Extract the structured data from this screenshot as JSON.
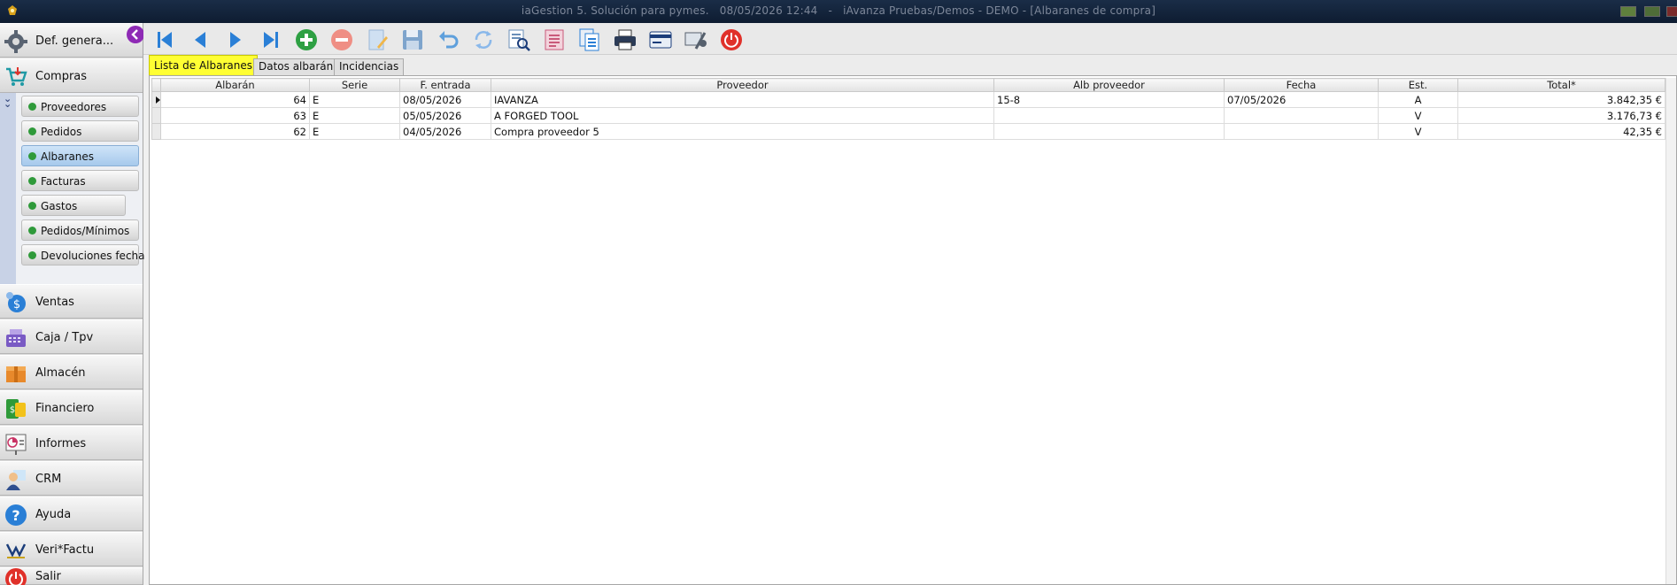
{
  "window": {
    "app_name": "iaGestion 5. Solución para pymes.",
    "datetime": "08/05/2026 12:44",
    "separator": "-",
    "company": "iAvanza Pruebas/Demos - DEMO - [Albaranes de compra]"
  },
  "sidebar": {
    "top_items": [
      {
        "label": "Def. genera...",
        "icon": "gear-icon"
      },
      {
        "label": "Compras",
        "icon": "shopping-cart-icon"
      }
    ],
    "sub_items": [
      {
        "label": "Proveedores"
      },
      {
        "label": "Pedidos"
      },
      {
        "label": "Albaranes"
      },
      {
        "label": "Facturas"
      },
      {
        "label": "Gastos"
      },
      {
        "label": "Pedidos/Mínimos"
      },
      {
        "label": "Devoluciones fecha"
      }
    ],
    "active_sub": "Albaranes",
    "bottom_items": [
      {
        "label": "Ventas",
        "icon": "sales-icon"
      },
      {
        "label": "Caja / Tpv",
        "icon": "cash-register-icon"
      },
      {
        "label": "Almacén",
        "icon": "warehouse-box-icon"
      },
      {
        "label": "Financiero",
        "icon": "money-icon"
      },
      {
        "label": "Informes",
        "icon": "report-chart-icon"
      },
      {
        "label": "CRM",
        "icon": "crm-person-icon"
      },
      {
        "label": "Ayuda",
        "icon": "help-icon"
      },
      {
        "label": "Veri*Factu",
        "icon": "verifactu-logo-icon"
      },
      {
        "label": "Salir",
        "icon": "exit-power-icon"
      }
    ]
  },
  "toolbar": {
    "tools": [
      "first-record-icon",
      "previous-record-icon",
      "next-record-icon",
      "last-record-icon",
      "add-icon",
      "delete-icon",
      "edit-icon",
      "save-icon",
      "undo-icon",
      "refresh-icon",
      "search-document-icon",
      "report-icon",
      "copy-document-icon",
      "print-icon",
      "card-icon",
      "tools-settings-icon",
      "close-power-icon"
    ]
  },
  "tabs": [
    {
      "label": "Lista de Albaranes",
      "active": true
    },
    {
      "label": "Datos albarán",
      "active": false
    },
    {
      "label": "Incidencias",
      "active": false
    }
  ],
  "grid": {
    "columns": [
      "Albarán",
      "Serie",
      "F. entrada",
      "Proveedor",
      "Alb proveedor",
      "Fecha",
      "Est.",
      "Total*"
    ],
    "rows": [
      {
        "albaran": "64",
        "serie": "E",
        "f_entrada": "08/05/2026",
        "proveedor": "IAVANZA",
        "alb_proveedor": "15-8",
        "fecha": "07/05/2026",
        "est": "A",
        "total": "3.842,35 €"
      },
      {
        "albaran": "63",
        "serie": "E",
        "f_entrada": "05/05/2026",
        "proveedor": "A FORGED TOOL",
        "alb_proveedor": "",
        "fecha": "",
        "est": "V",
        "total": "3.176,73 €"
      },
      {
        "albaran": "62",
        "serie": "E",
        "f_entrada": "04/05/2026",
        "proveedor": "Compra proveedor 5",
        "alb_proveedor": "",
        "fecha": "",
        "est": "V",
        "total": "42,35 €"
      }
    ]
  },
  "colors": {
    "title_bar": "#0e1c31",
    "active_tab": "#ffff33",
    "active_sub_item": "#a6c9ec",
    "status_dot": "#2f9a3a",
    "nav_arrow": "#2a7fd6",
    "add": "#2ea043",
    "delete": "#e86a5c",
    "power": "#e0312a"
  }
}
